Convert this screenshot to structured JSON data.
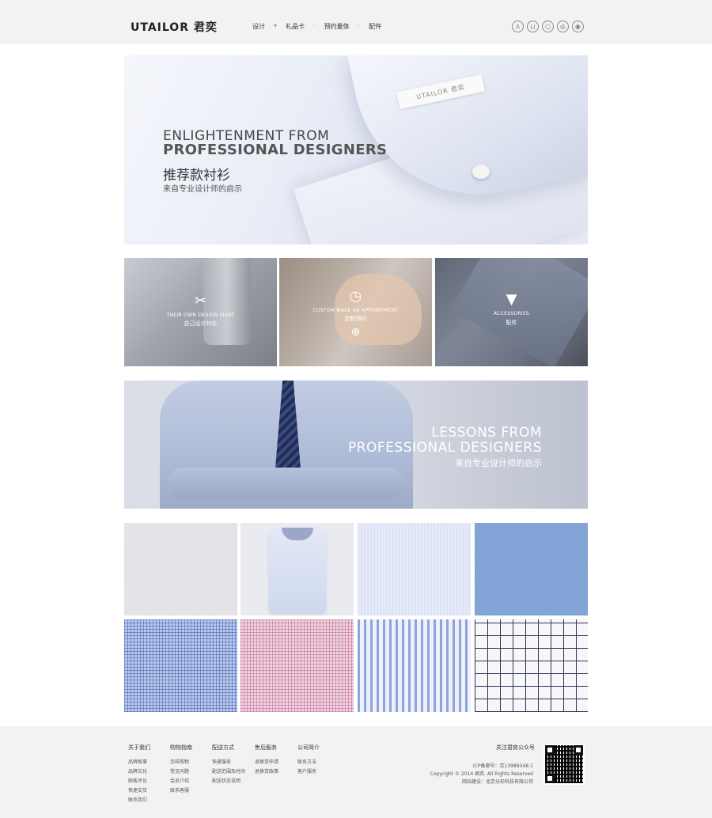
{
  "header": {
    "logo": "UTAILOR 君奕",
    "nav": [
      "设计",
      "礼品卡",
      "预约量体",
      "配件"
    ],
    "icons": [
      "user-icon",
      "cart-icon",
      "search-icon",
      "wechat-icon",
      "weibo-icon"
    ]
  },
  "banner1": {
    "tag": "UTAILOR 君奕",
    "en_line1": "ENLIGHTENMENT FROM",
    "en_line2": "PROFESSIONAL DESIGNERS",
    "cn_title": "推荐款衬衫",
    "cn_sub": "来自专业设计师的启示"
  },
  "tiles": [
    {
      "icon": "scissors-icon",
      "glyph": "✂",
      "en": "THEIR OWN DESIGN SHIRT",
      "cn": "自己设计衬衫"
    },
    {
      "icon": "clock-icon",
      "glyph": "◷",
      "en": "CUSTOM MAKE AN APPOINTMENT",
      "cn": "定制预约",
      "extra_glyph": "⊕"
    },
    {
      "icon": "tie-icon",
      "glyph": "▼",
      "en": "ACCESSORIES",
      "cn": "配件"
    }
  ],
  "banner2": {
    "en_line1": "LESSONS FROM",
    "en_line2": "PROFESSIONAL DESIGNERS",
    "cn_sub": "来自专业设计师的启示"
  },
  "footer": {
    "columns": [
      {
        "title": "关于我们",
        "items": [
          "品牌故事",
          "品牌文化",
          "顾客评论",
          "快速交货",
          "联系我们"
        ]
      },
      {
        "title": "购物指南",
        "items": [
          "怎样购物",
          "常见问题",
          "会员介绍",
          "联系客服"
        ]
      },
      {
        "title": "配送方式",
        "items": [
          "快递服务",
          "配送范围及时间",
          "配送状态说明"
        ]
      },
      {
        "title": "售后服务",
        "items": [
          "退换货申请",
          "退换货政策"
        ]
      },
      {
        "title": "公司简介",
        "items": [
          "联系方法",
          "客户服务"
        ]
      }
    ],
    "follow": "关注君奕公众号",
    "icp": "ICP备案号：京13989348-1",
    "copyright": "Copyright © 2014 君奕. All Rights Reserved",
    "builder": "网站建设：北京分形科技有限公司"
  }
}
